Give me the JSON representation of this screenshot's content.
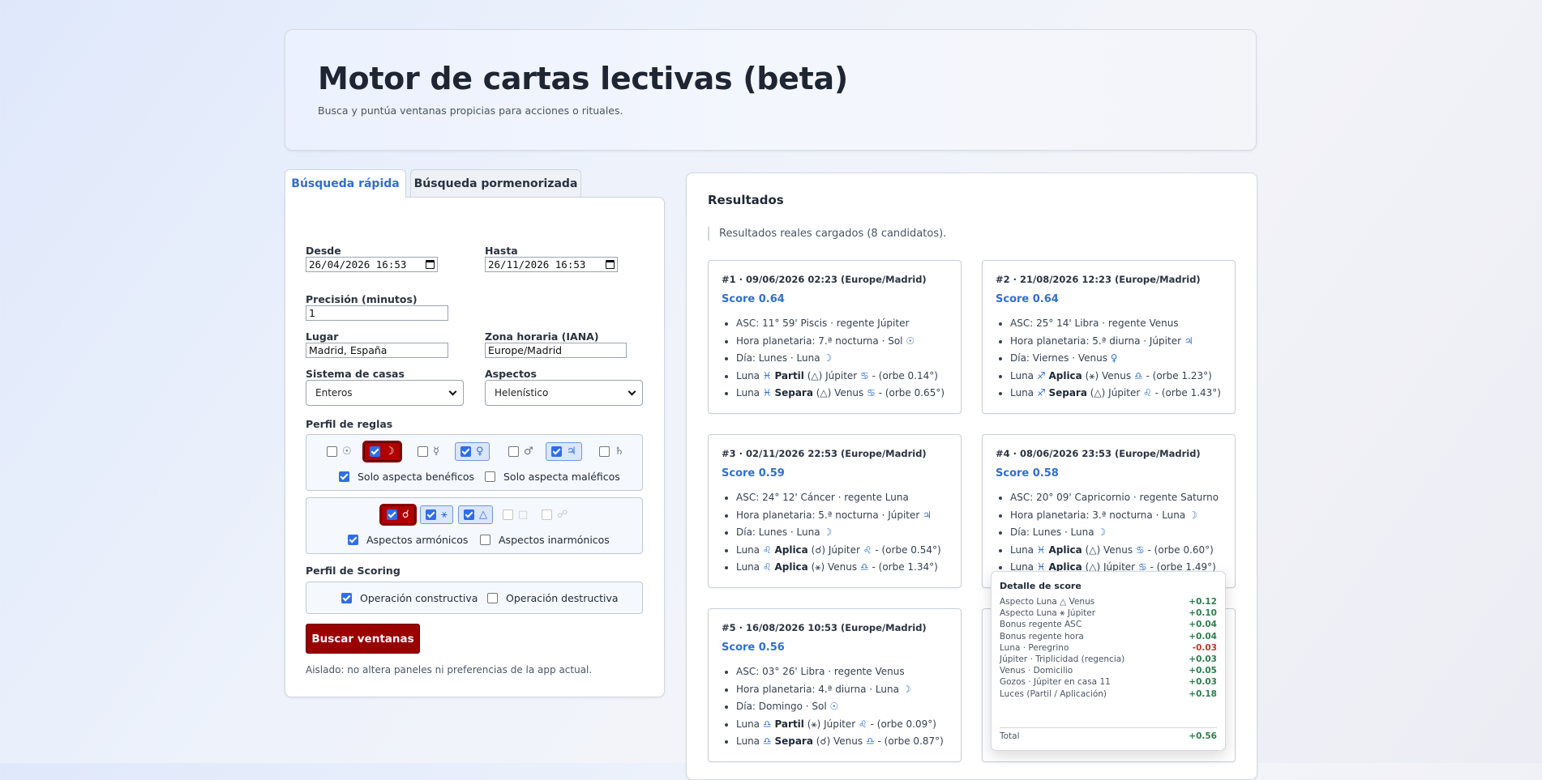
{
  "header": {
    "title": "Motor de cartas lectivas (beta)",
    "subtitle": "Busca y puntúa ventanas propicias para acciones o rituales."
  },
  "tabs": [
    {
      "label": "Búsqueda rápida",
      "active": true
    },
    {
      "label": "Búsqueda pormenorizada",
      "active": false
    }
  ],
  "form": {
    "desde_label": "Desde",
    "desde_value": "26/04/2026 16:53",
    "hasta_label": "Hasta",
    "hasta_value": "26/11/2026 16:53",
    "precision_label": "Precisión (minutos)",
    "precision_value": "1",
    "lugar_label": "Lugar",
    "lugar_value": "Madrid, España",
    "zona_label": "Zona horaria (IANA)",
    "zona_value": "Europe/Madrid",
    "casas_label": "Sistema de casas",
    "casas_value": "Enteros",
    "aspectos_label": "Aspectos",
    "aspectos_value": "Helenístico",
    "perfil_reglas_label": "Perfil de reglas",
    "planets": [
      {
        "symbol": "☉",
        "name": "sun",
        "checked": false,
        "state": "plain"
      },
      {
        "symbol": "☽",
        "name": "moon",
        "checked": true,
        "state": "red"
      },
      {
        "symbol": "☿",
        "name": "mercury",
        "checked": false,
        "state": "plain"
      },
      {
        "symbol": "♀",
        "name": "venus",
        "checked": true,
        "state": "sel"
      },
      {
        "symbol": "♂",
        "name": "mars",
        "checked": false,
        "state": "plain"
      },
      {
        "symbol": "♃",
        "name": "jupiter",
        "checked": true,
        "state": "sel"
      },
      {
        "symbol": "♄",
        "name": "saturn",
        "checked": false,
        "state": "plain"
      }
    ],
    "solo_beneficos": {
      "label": "Solo aspecta benéficos",
      "checked": true
    },
    "solo_maleficos": {
      "label": "Solo aspecta maléficos",
      "checked": false
    },
    "aspect_chips": [
      {
        "symbol": "☌",
        "name": "conjunction",
        "checked": true,
        "state": "red"
      },
      {
        "symbol": "⚹",
        "name": "sextile",
        "checked": true,
        "state": "sel"
      },
      {
        "symbol": "△",
        "name": "trine",
        "checked": true,
        "state": "sel"
      },
      {
        "symbol": "□",
        "name": "square",
        "checked": false,
        "state": "faint"
      },
      {
        "symbol": "☍",
        "name": "opposition",
        "checked": false,
        "state": "faint"
      }
    ],
    "armonicos": {
      "label": "Aspectos armónicos",
      "checked": true
    },
    "inarmonicos": {
      "label": "Aspectos inarmónicos",
      "checked": false
    },
    "perfil_scoring_label": "Perfil de Scoring",
    "constructiva": {
      "label": "Operación constructiva",
      "checked": true
    },
    "destructiva": {
      "label": "Operación destructiva",
      "checked": false
    },
    "submit_label": "Buscar ventanas",
    "note": "Aislado: no altera paneles ni preferencias de la app actual."
  },
  "results": {
    "title": "Resultados",
    "status": "Resultados reales cargados (8 candidatos).",
    "cards": [
      {
        "head": "#1 · 09/06/2026 02:23 (Europe/Madrid)",
        "score": "Score 0.64",
        "items": [
          "ASC: 11° 59' Piscis · regente Júpiter",
          "Hora planetaria: 7.ª nocturna · Sol ☉",
          "Día: Lunes · Luna ☽",
          "Luna ♓ <b>Partil</b> (△) Júpiter ♋ - (orbe 0.14°)",
          "Luna ♓ <b>Separa</b> (△) Venus ♋ - (orbe 0.65°)"
        ]
      },
      {
        "head": "#2 · 21/08/2026 12:23 (Europe/Madrid)",
        "score": "Score 0.64",
        "items": [
          "ASC: 25° 14' Libra · regente Venus",
          "Hora planetaria: 5.ª diurna · Júpiter ♃",
          "Día: Viernes · Venus ♀",
          "Luna ♐ <b>Aplica</b> (⚹) Venus ♎ - (orbe 1.23°)",
          "Luna ♐ <b>Separa</b> (△) Júpiter ♌ - (orbe 1.43°)"
        ]
      },
      {
        "head": "#3 · 02/11/2026 22:53 (Europe/Madrid)",
        "score": "Score 0.59",
        "items": [
          "ASC: 24° 12' Cáncer · regente Luna",
          "Hora planetaria: 5.ª nocturna · Júpiter ♃",
          "Día: Lunes · Luna ☽",
          "Luna ♌ <b>Aplica</b> (☌) Júpiter ♌ - (orbe 0.54°)",
          "Luna ♌ <b>Aplica</b> (⚹) Venus ♎ - (orbe 1.34°)"
        ]
      },
      {
        "head": "#4 · 08/06/2026 23:53 (Europe/Madrid)",
        "score": "Score 0.58",
        "items": [
          "ASC: 20° 09' Capricornio · regente Saturno",
          "Hora planetaria: 3.ª nocturna · Luna ☽",
          "Día: Lunes · Luna ☽",
          "Luna ♓ <b>Aplica</b> (△) Venus ♋ - (orbe 0.60°)",
          "Luna ♓ <b>Aplica</b> (△) Júpiter ♋ - (orbe 1.49°)"
        ]
      },
      {
        "head": "#5 · 16/08/2026 10:53 (Europe/Madrid)",
        "score": "Score 0.56",
        "items": [
          "ASC: 03° 26' Libra · regente Venus",
          "Hora planetaria: 4.ª diurna · Luna ☽",
          "Día: Domingo · Sol ☉",
          "Luna ♎ <b>Partil</b> (⚹) Júpiter ♌ - (orbe 0.09°)",
          "Luna ♎ <b>Separa</b> (☌) Venus ♎ - (orbe 0.87°)"
        ]
      }
    ]
  },
  "score_detail": {
    "title": "Detalle de score",
    "rows": [
      {
        "label": "Aspecto Luna △ Venus",
        "value": "+0.12",
        "negative": false
      },
      {
        "label": "Aspecto Luna ⚹ Júpiter",
        "value": "+0.10",
        "negative": false
      },
      {
        "label": "Bonus regente ASC",
        "value": "+0.04",
        "negative": false
      },
      {
        "label": "Bonus regente hora",
        "value": "+0.04",
        "negative": false
      },
      {
        "label": "Luna · Peregrino",
        "value": "-0.03",
        "negative": true
      },
      {
        "label": "Júpiter · Triplicidad (regencia)",
        "value": "+0.03",
        "negative": false
      },
      {
        "label": "Venus · Domicilio",
        "value": "+0.05",
        "negative": false
      },
      {
        "label": "Gozos · Júpiter en casa 11",
        "value": "+0.03",
        "negative": false
      },
      {
        "label": "Luces (Partil / Aplicación)",
        "value": "+0.18",
        "negative": false
      }
    ],
    "total_label": "Total",
    "total_value": "+0.56"
  },
  "colors": {
    "accent": "#2f6fd1",
    "primary_button": "#990000",
    "positive": "#2e7d4f",
    "negative": "#c0392b"
  }
}
